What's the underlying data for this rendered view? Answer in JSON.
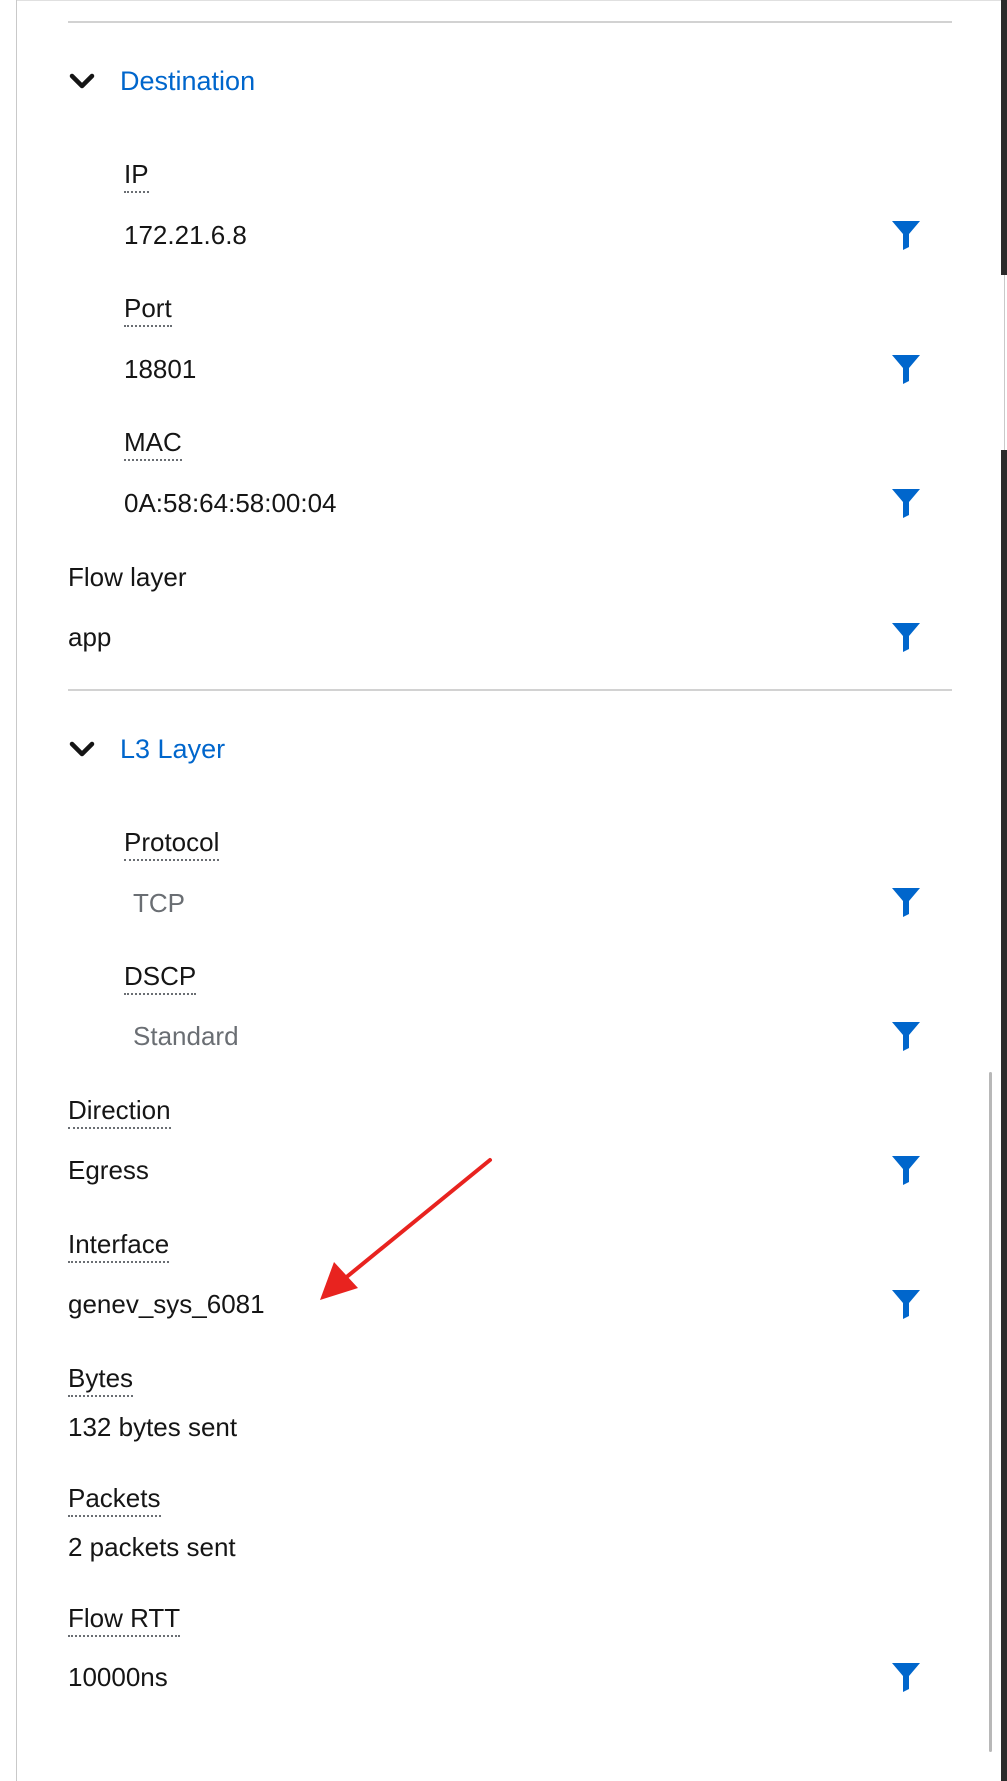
{
  "destination": {
    "title": "Destination",
    "ip": {
      "label": "IP",
      "value": "172.21.6.8"
    },
    "port": {
      "label": "Port",
      "value": "18801"
    },
    "mac": {
      "label": "MAC",
      "value": "0A:58:64:58:00:04"
    }
  },
  "flow_layer": {
    "label": "Flow layer",
    "value": "app"
  },
  "l3_layer": {
    "title": "L3 Layer",
    "protocol": {
      "label": "Protocol",
      "value": "TCP"
    },
    "dscp": {
      "label": "DSCP",
      "value": "Standard"
    }
  },
  "direction": {
    "label": "Direction",
    "value": "Egress"
  },
  "interface": {
    "label": "Interface",
    "value": "genev_sys_6081"
  },
  "bytes": {
    "label": "Bytes",
    "value": "132 bytes sent"
  },
  "packets": {
    "label": "Packets",
    "value": "2 packets sent"
  },
  "flow_rtt": {
    "label": "Flow RTT",
    "value": "10000ns"
  },
  "icons": {
    "section_toggle": "chevron-down-icon",
    "filter": "filter-icon",
    "annotation": "red-arrow-annotation"
  },
  "colors": {
    "accent": "#0066cc",
    "text": "#151515",
    "muted": "#6a6e73",
    "divider": "#d2d2d2",
    "annotation": "#e8231f"
  }
}
